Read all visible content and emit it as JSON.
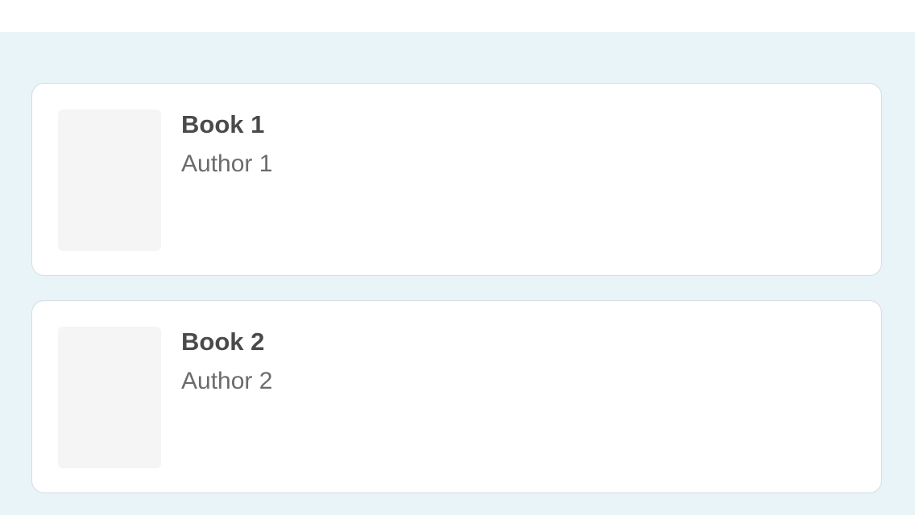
{
  "books": [
    {
      "title": "Book 1",
      "author": "Author 1"
    },
    {
      "title": "Book 2",
      "author": "Author 2"
    }
  ]
}
